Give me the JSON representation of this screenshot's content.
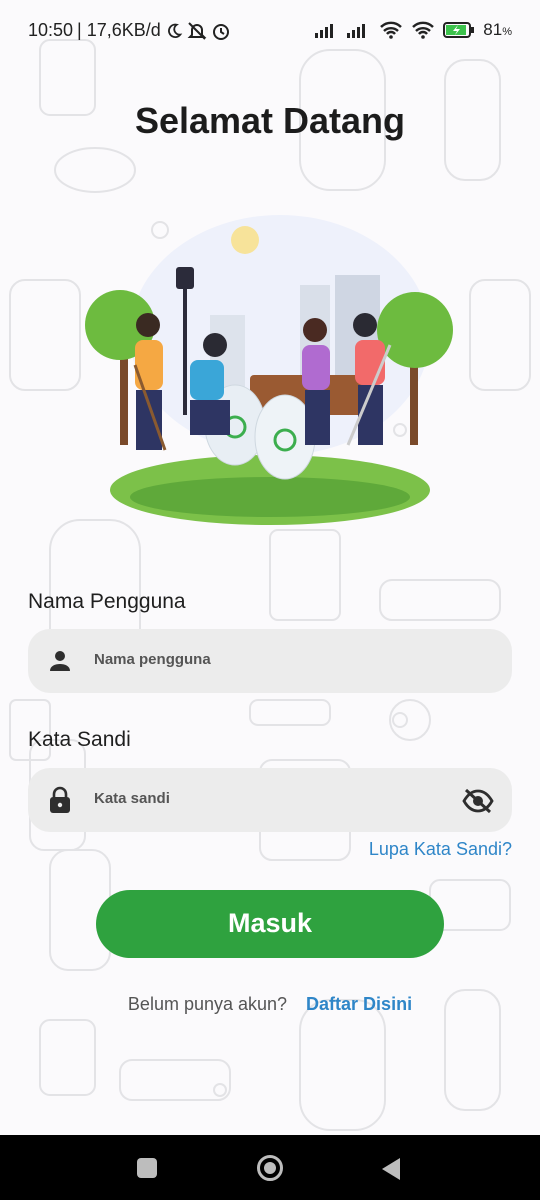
{
  "status_bar": {
    "time": "10:50",
    "speed": "| 17,6KB/d",
    "battery": "81",
    "battery_unit": "%"
  },
  "title": "Selamat Datang",
  "illustration": {
    "name": "people-cleaning-park-illustration"
  },
  "username": {
    "label": "Nama Pengguna",
    "placeholder": "Nama pengguna",
    "icon": "person-icon"
  },
  "password": {
    "label": "Kata Sandi",
    "placeholder": "Kata sandi",
    "icon": "lock-icon",
    "toggle_icon": "eye-off-icon"
  },
  "forgot_password": "Lupa Kata Sandi?",
  "login_button": "Masuk",
  "register": {
    "prompt": "Belum punya akun?",
    "link": "Daftar Disini"
  },
  "colors": {
    "primary_green": "#2fa23f",
    "link_blue": "#2f86c8",
    "input_bg": "#ececec"
  }
}
